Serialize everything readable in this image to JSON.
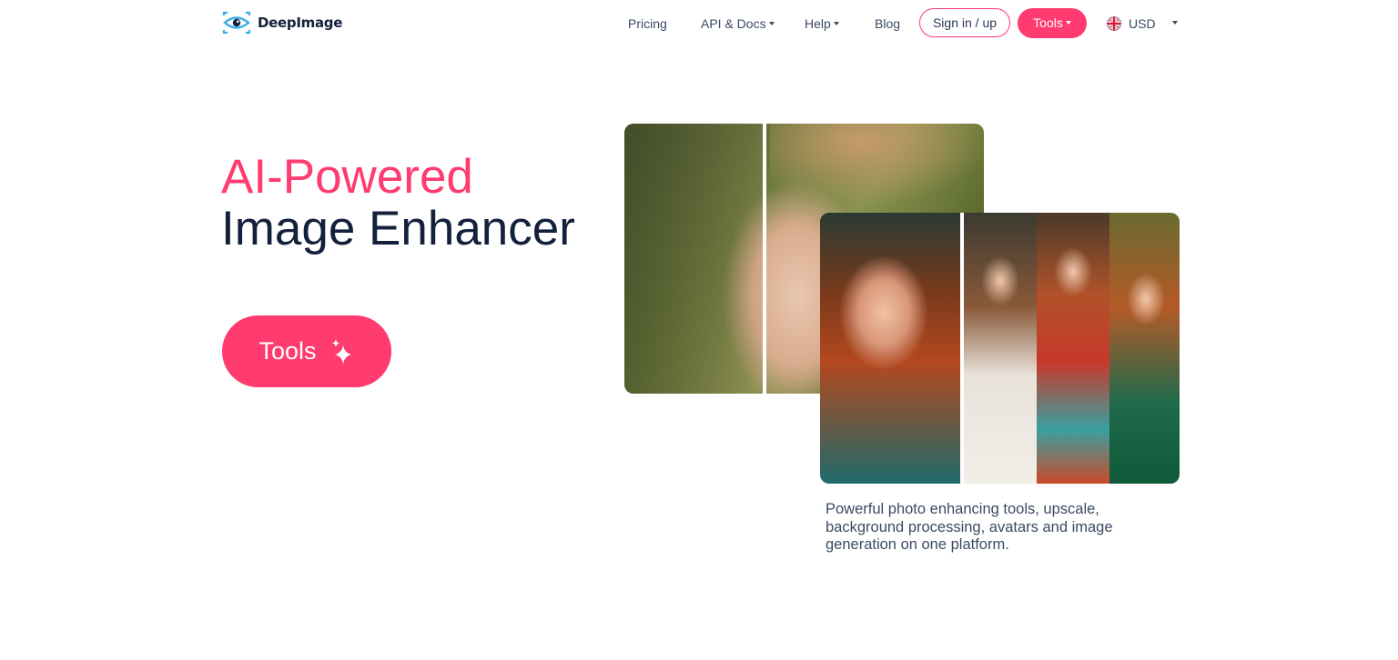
{
  "brand": {
    "name": "DeepImage"
  },
  "nav": {
    "pricing": "Pricing",
    "api_docs": "API & Docs",
    "help": "Help",
    "blog": "Blog",
    "sign_in": "Sign in / up",
    "tools": "Tools",
    "currency": "USD"
  },
  "hero": {
    "title_line1": "AI-Powered",
    "title_line2": "Image Enhancer",
    "cta_label": "Tools"
  },
  "description": "Powerful photo enhancing tools, upscale, background processing, avatars and image generation on one platform.",
  "icons": {
    "logo": "eye-logo-icon",
    "flag": "uk-flag-icon",
    "cta": "sparkles-icon"
  },
  "colors": {
    "accent": "#ff3b6f",
    "heading": "#14213d",
    "text": "#3b4a63"
  }
}
